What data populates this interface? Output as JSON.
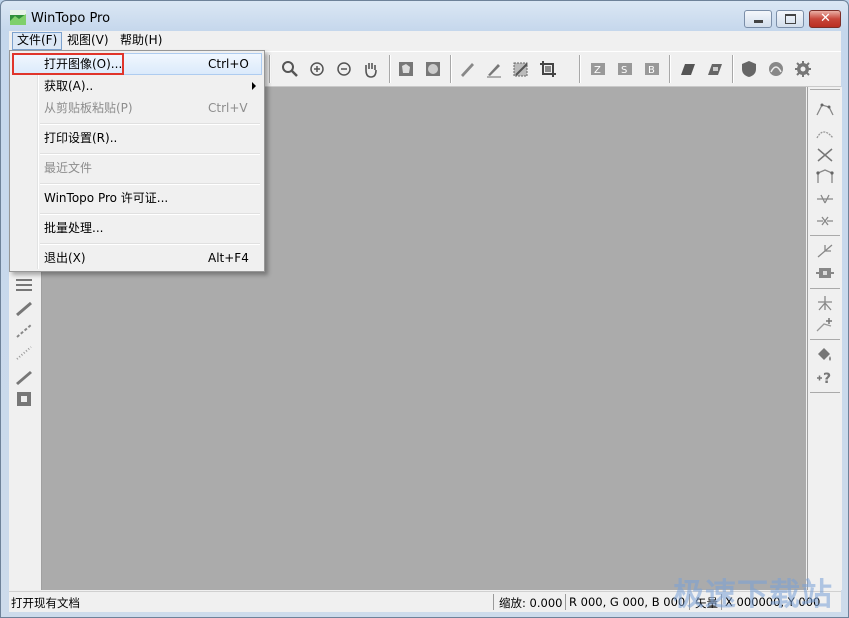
{
  "window": {
    "title": "WinTopo Pro"
  },
  "menubar": {
    "file": "文件(F)",
    "view": "视图(V)",
    "help": "帮助(H)"
  },
  "file_menu": {
    "open_image": {
      "label": "打开图像(O)...",
      "shortcut": "Ctrl+O"
    },
    "acquire": {
      "label": "获取(A).."
    },
    "paste": {
      "label": "从剪贴板粘贴(P)",
      "shortcut": "Ctrl+V"
    },
    "print_setup": {
      "label": "打印设置(R).."
    },
    "recent": {
      "label": "最近文件"
    },
    "license": {
      "label": "WinTopo Pro 许可证..."
    },
    "batch": {
      "label": "批量处理..."
    },
    "exit": {
      "label": "退出(X)",
      "shortcut": "Alt+F4"
    }
  },
  "statusbar": {
    "message": "打开现有文档",
    "zoom": "缩放: 0.000",
    "rgb": "R 000, G 000, B 000",
    "vector": "矢量",
    "coords": "X 000000, Y 000"
  },
  "watermark": "极速下载站",
  "colors": {
    "canvas": "#ababab",
    "highlight_border": "#e0352b",
    "menu_bg": "#f0f0f0"
  }
}
